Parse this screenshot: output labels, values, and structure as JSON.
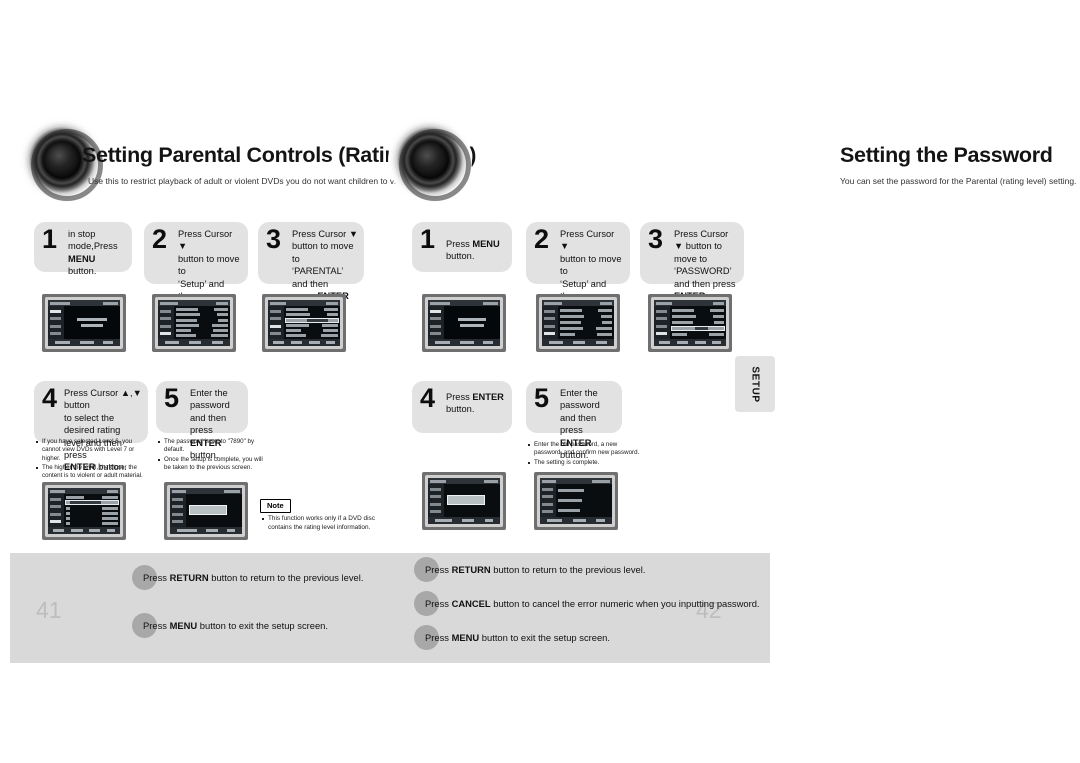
{
  "document": {
    "left_page_number": "41",
    "right_page_number": "42",
    "side_tab_label": "SETUP"
  },
  "left_section": {
    "title": "Setting Parental Controls (Rating Level)",
    "subtitle": "Use this to restrict playback of adult or violent DVDs you do not want children to view.",
    "steps": [
      {
        "number": "1",
        "text_html": "in stop mode,Press<br><b>MENU</b>&nbsp; button."
      },
      {
        "number": "2",
        "text_html": "Press Cursor &#9660;<br>button to move to<br>&lsquo;Setup&rsquo; and then<br>press <b>ENTER</b> button."
      },
      {
        "number": "3",
        "text_html": "Press Cursor &#9660;<br>button to move to<br>&lsquo;PARENTAL&rsquo; and then<br>press <b>ENTER</b> button."
      },
      {
        "number": "4",
        "text_html": "Press Cursor &#9650;,&#9660; button<br>to select the desired rating<br>level and then press<br><b>ENTER</b> button."
      },
      {
        "number": "5",
        "text_html": "Enter the password<br>and then press<br><b>ENTER</b> button."
      }
    ],
    "step4_notes": [
      "If you have selected Level 6, you cannot view DVDs with Level 7 or higher.",
      "The higher the level, the closer the content is to violent or adult material."
    ],
    "step5_notes": [
      "The password is set to \"7890\" by default.",
      "Once the setup is complete, you will be taken to the previous screen."
    ],
    "note_badge": {
      "label": "Note",
      "items": [
        "This function works only if a DVD disc contains the rating level information."
      ]
    },
    "footer_lines": [
      {
        "prefix": "Press ",
        "key": "RETURN",
        "suffix": " button to return to the previous level."
      },
      {
        "prefix": "Press ",
        "key": "MENU",
        "suffix": " button to exit the setup screen."
      }
    ]
  },
  "right_section": {
    "title": "Setting the Password",
    "subtitle": "You can set the password for the Parental (rating level) setting.",
    "steps": [
      {
        "number": "1",
        "text_html": "Press <b>MENU</b> button."
      },
      {
        "number": "2",
        "text_html": "Press Cursor &#9660;<br>button to move to<br>&lsquo;Setup&rsquo; and then<br>press <b>ENTER</b> button."
      },
      {
        "number": "3",
        "text_html": "Press Cursor &#9660; button to<br>move to &lsquo;PASSWORD&rsquo;<br>and then press <b>ENTER</b><br>button."
      },
      {
        "number": "4",
        "text_html": "Press <b>ENTER</b><br>button."
      },
      {
        "number": "5",
        "text_html": "Enter the password<br>and then press<br><b>ENTER</b> button."
      }
    ],
    "step5_notes": [
      "Enter the old password, a new password, and confirm new password.",
      "The setting is complete."
    ],
    "footer_lines": [
      {
        "prefix": "Press ",
        "key": "RETURN",
        "suffix": " button to return to the previous level."
      },
      {
        "prefix": "Press ",
        "key": "CANCEL",
        "suffix": " button to cancel the error numeric when you inputting password."
      },
      {
        "prefix": "Press ",
        "key": "MENU",
        "suffix": " button to exit the setup screen."
      }
    ]
  },
  "colors": {
    "bubble_bg": "#e2e2e2",
    "footer_bg": "#d9d9d9",
    "page_number": "#bdbdbd",
    "dot": "#a8a8a8"
  }
}
